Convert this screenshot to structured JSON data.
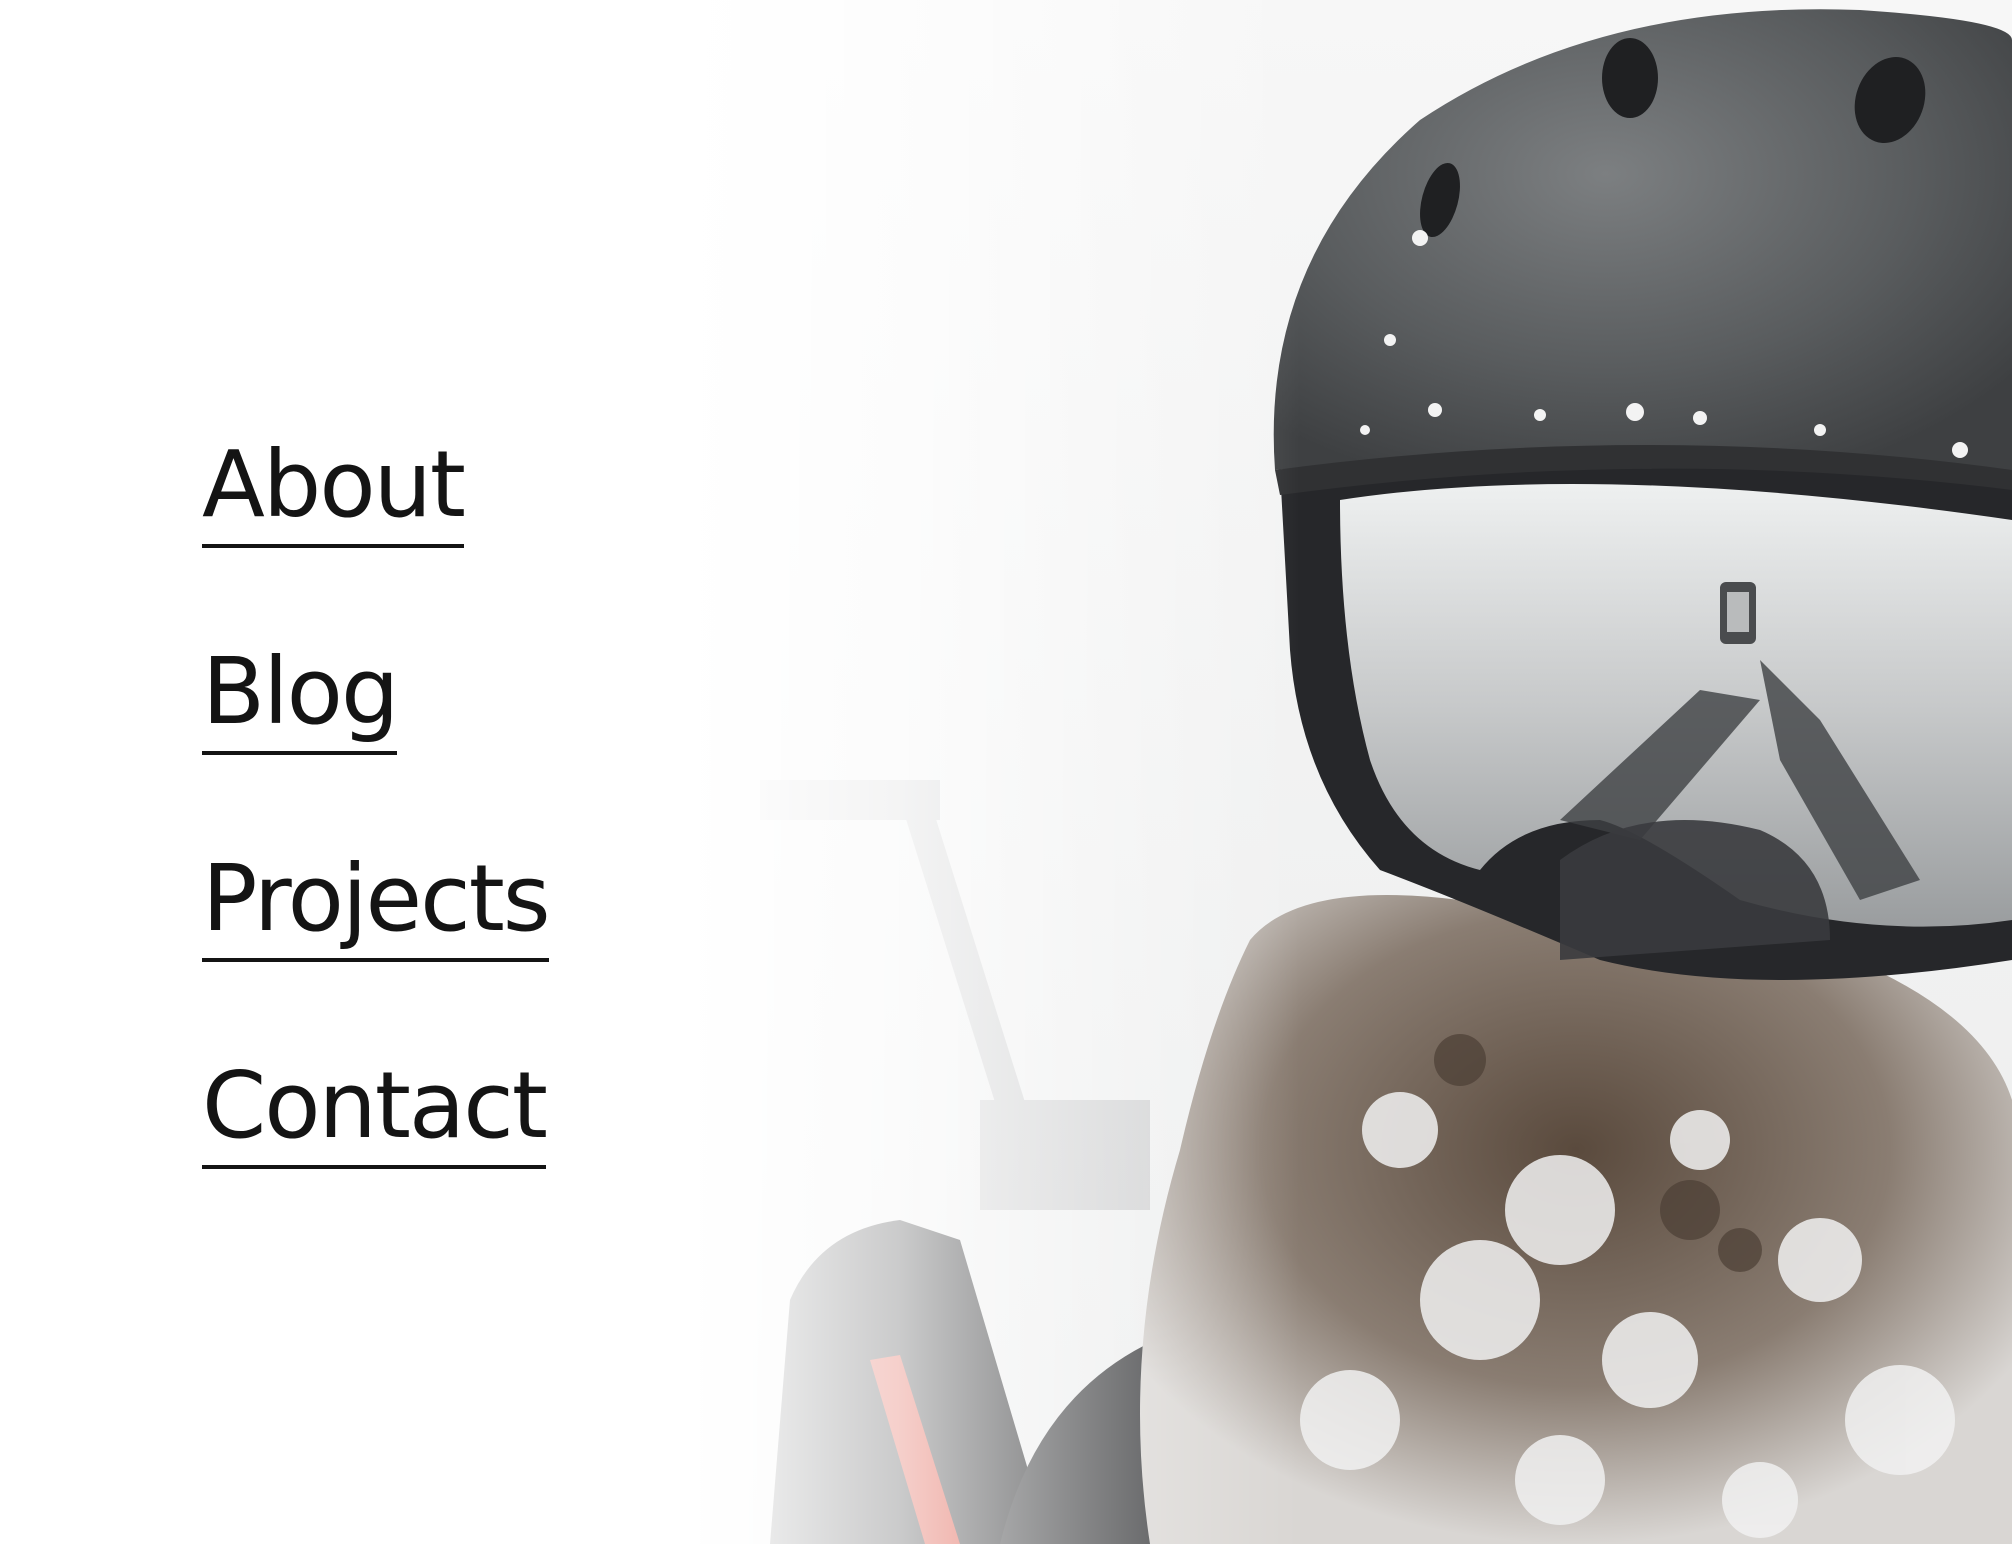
{
  "nav": {
    "items": [
      {
        "label": "About"
      },
      {
        "label": "Blog"
      },
      {
        "label": "Projects"
      },
      {
        "label": "Contact"
      }
    ]
  },
  "hero": {
    "icon": "skier-selfie-photo",
    "palette": {
      "helmet": "#56595b",
      "goggle_strap": "#2a2b2c",
      "lens": "#cfd1d2",
      "beard": "#6b5a4c",
      "snow": "#f2f2f2",
      "accent_red": "#d9412f"
    }
  },
  "colors": {
    "background": "#ffffff",
    "nav_text": "#141414"
  }
}
